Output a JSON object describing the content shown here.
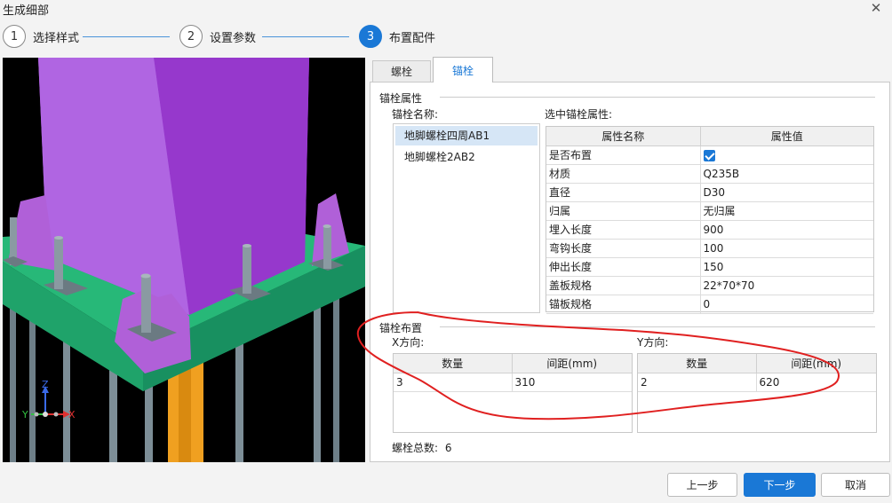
{
  "window": {
    "title": "生成细部",
    "close_glyph": "✕"
  },
  "steps": [
    {
      "number": "1",
      "label": "选择样式"
    },
    {
      "number": "2",
      "label": "设置参数"
    },
    {
      "number": "3",
      "label": "布置配件"
    }
  ],
  "viewport": {
    "axis_x": "X",
    "axis_y": "Y",
    "axis_z": "Z"
  },
  "tabs": [
    {
      "label": "螺栓"
    },
    {
      "label": "锚栓"
    }
  ],
  "anchor_props": {
    "group_title": "锚栓属性",
    "name_label": "锚栓名称:",
    "names": [
      "地脚螺栓四周AB1",
      "地脚螺栓2AB2"
    ],
    "selected_label": "选中锚栓属性:",
    "grid_headers": [
      "属性名称",
      "属性值"
    ],
    "rows": [
      {
        "name": "是否布置",
        "value": "",
        "checked": true
      },
      {
        "name": "材质",
        "value": "Q235B"
      },
      {
        "name": "直径",
        "value": "D30"
      },
      {
        "name": "归属",
        "value": "无归属"
      },
      {
        "name": "埋入长度",
        "value": "900"
      },
      {
        "name": "弯钩长度",
        "value": "100"
      },
      {
        "name": "伸出长度",
        "value": "150"
      },
      {
        "name": "盖板规格",
        "value": "22*70*70"
      },
      {
        "name": "锚板规格",
        "value": "0"
      }
    ]
  },
  "layout_group": {
    "group_title": "锚栓布置",
    "x_label": "X方向:",
    "y_label": "Y方向:",
    "headers": [
      "数量",
      "间距(mm)"
    ],
    "x_row": {
      "count": "3",
      "spacing": "310"
    },
    "y_row": {
      "count": "2",
      "spacing": "620"
    },
    "total_label": "螺栓总数:",
    "total_value": "6"
  },
  "buttons": {
    "prev": "上一步",
    "next": "下一步",
    "cancel": "取消"
  },
  "colors": {
    "accent": "#1a78d6",
    "column": "#a64bd9",
    "plate": "#1fa36a",
    "annotation": "#e02020"
  }
}
